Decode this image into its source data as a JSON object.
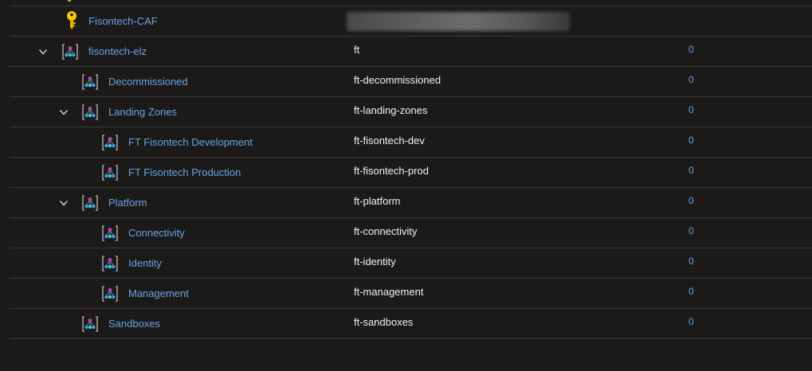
{
  "rows": [
    {
      "name": "Fisontech-CAF",
      "id": "",
      "count": "",
      "icon": "key-icon",
      "level": 0,
      "expandable": false,
      "redacted": true
    },
    {
      "name": "fisontech-elz",
      "id": "ft",
      "count": "0",
      "icon": "management-group-icon",
      "level": 1,
      "expandable": true
    },
    {
      "name": "Decommissioned",
      "id": "ft-decommissioned",
      "count": "0",
      "icon": "management-group-icon",
      "level": 2,
      "expandable": false
    },
    {
      "name": "Landing Zones",
      "id": "ft-landing-zones",
      "count": "0",
      "icon": "management-group-icon",
      "level": 2,
      "expandable": true
    },
    {
      "name": "FT Fisontech Development",
      "id": "ft-fisontech-dev",
      "count": "0",
      "icon": "management-group-icon",
      "level": 3,
      "expandable": false
    },
    {
      "name": "FT Fisontech Production",
      "id": "ft-fisontech-prod",
      "count": "0",
      "icon": "management-group-icon",
      "level": 3,
      "expandable": false
    },
    {
      "name": "Platform",
      "id": "ft-platform",
      "count": "0",
      "icon": "management-group-icon",
      "level": 2,
      "expandable": true
    },
    {
      "name": "Connectivity",
      "id": "ft-connectivity",
      "count": "0",
      "icon": "management-group-icon",
      "level": 3,
      "expandable": false
    },
    {
      "name": "Identity",
      "id": "ft-identity",
      "count": "0",
      "icon": "management-group-icon",
      "level": 3,
      "expandable": false
    },
    {
      "name": "Management",
      "id": "ft-management",
      "count": "0",
      "icon": "management-group-icon",
      "level": 3,
      "expandable": false
    },
    {
      "name": "Sandboxes",
      "id": "ft-sandboxes",
      "count": "0",
      "icon": "management-group-icon",
      "level": 2,
      "expandable": false
    }
  ],
  "colors": {
    "link": "#69a3e0",
    "text": "#f3f2f1",
    "background": "#1b1a19",
    "divider": "#3b3a39",
    "key": "#f2c811"
  }
}
